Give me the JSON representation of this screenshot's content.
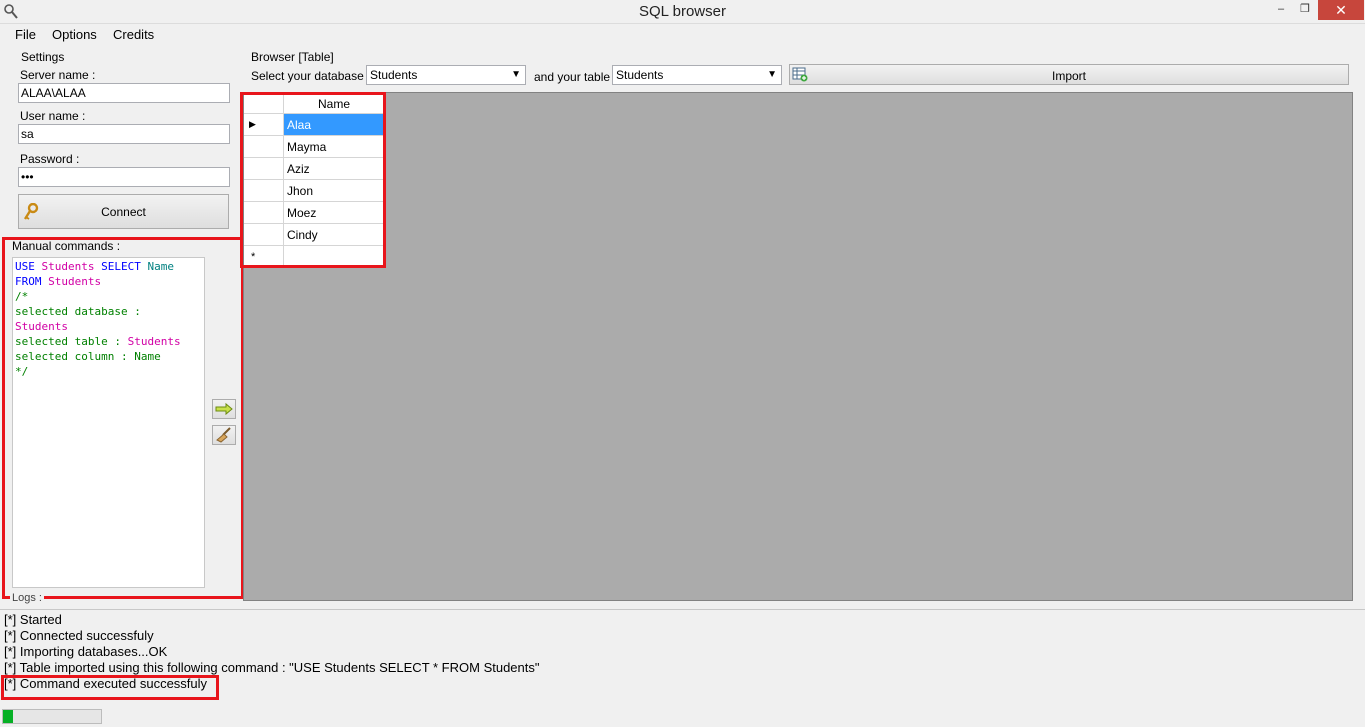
{
  "window": {
    "title": "SQL browser",
    "minimize": "–",
    "restore": "❐",
    "close": "✕"
  },
  "menu": {
    "file": "File",
    "options": "Options",
    "credits": "Credits"
  },
  "settings": {
    "group_label": "Settings",
    "server_label": "Server name :",
    "server_value": "ALAA\\ALAA",
    "user_label": "User name :",
    "user_value": "sa",
    "password_label": "Password :",
    "password_value": "•••",
    "connect_label": "Connect"
  },
  "manual": {
    "group_label": "Manual commands :",
    "lines": [
      [
        {
          "t": "USE ",
          "c": "kw"
        },
        {
          "t": "Students ",
          "c": "id"
        },
        {
          "t": "SELECT ",
          "c": "kw"
        },
        {
          "t": "Name",
          "c": "col"
        }
      ],
      [
        {
          "t": "FROM ",
          "c": "kw"
        },
        {
          "t": "Students",
          "c": "id"
        }
      ],
      [
        {
          "t": "/*",
          "c": "cm"
        }
      ],
      [
        {
          "t": "selected database :",
          "c": "cm"
        }
      ],
      [
        {
          "t": "Students",
          "c": "id"
        }
      ],
      [
        {
          "t": "selected table : ",
          "c": "cm"
        },
        {
          "t": "Students",
          "c": "id"
        }
      ],
      [
        {
          "t": "selected column : Name",
          "c": "cm"
        }
      ],
      [
        {
          "t": "*/",
          "c": "cm"
        }
      ]
    ]
  },
  "browser": {
    "group_label": "Browser [Table]",
    "db_label": "Select your database :",
    "db_value": "Students",
    "table_label": "and your table :",
    "table_value": "Students",
    "import_label": "Import"
  },
  "grid": {
    "column": "Name",
    "rows": [
      "Alaa",
      "Mayma",
      "Aziz",
      "Jhon",
      "Moez",
      "Cindy"
    ],
    "selected_index": 0,
    "new_row_marker": "*",
    "current_marker": "▶"
  },
  "logs": {
    "group_label": "Logs :",
    "lines": [
      "[*] Started",
      "[*] Connected successfuly",
      "[*] Importing databases...OK",
      "[*] Table imported using this following command : \"USE Students SELECT * FROM Students\"",
      "[*] Command executed successfuly"
    ]
  },
  "status": {
    "progress": 0.1
  },
  "colors": {
    "highlight": "#e8151b",
    "selection": "#3399ff",
    "progress": "#06b025"
  }
}
